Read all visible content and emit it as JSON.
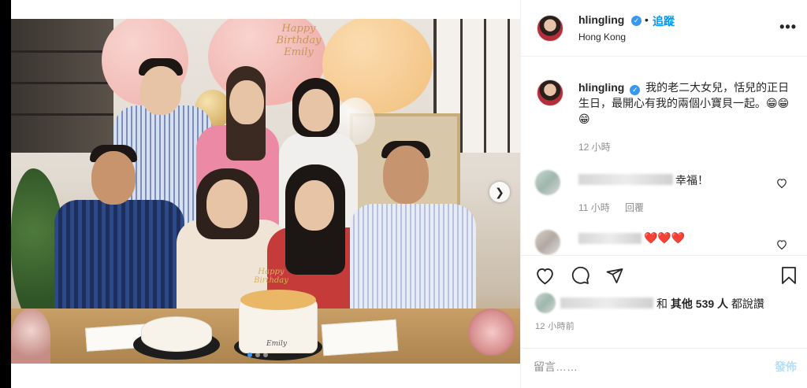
{
  "post": {
    "username": "hlingling",
    "verified_mark": "✓",
    "follow_label": "追蹤",
    "separator": "•",
    "location": "Hong Kong",
    "more_label": "•••",
    "caption": "我的老二大女兒，恬兒的正日生日，最開心有我的兩個小寶貝一起。😁😁😁",
    "caption_time": "12 小時"
  },
  "photo": {
    "balloon_text": "Happy Birthday Emily",
    "cake_text": "Emily",
    "topper_text": "Happy Birthday",
    "next_icon": "chevron-right-icon"
  },
  "comments": [
    {
      "text": "幸福！",
      "time": "11 小時",
      "reply_label": "回覆"
    },
    {
      "text": "❤️❤️❤️"
    }
  ],
  "actions": {
    "like_icon": "heart-icon",
    "comment_icon": "comment-bubble-icon",
    "share_icon": "paper-plane-icon",
    "save_icon": "bookmark-icon"
  },
  "likes": {
    "prefix": "和 ",
    "others_text": "其他 539 人",
    "suffix": " 都說讚"
  },
  "post_time": "12 小時前",
  "comment_box": {
    "placeholder": "留言……",
    "post_label": "發佈"
  },
  "colors": {
    "accent_blue": "#0095f6",
    "verified_blue": "#3897f0",
    "muted_text": "#8e8e8e",
    "disabled_post": "#b2dffc"
  }
}
